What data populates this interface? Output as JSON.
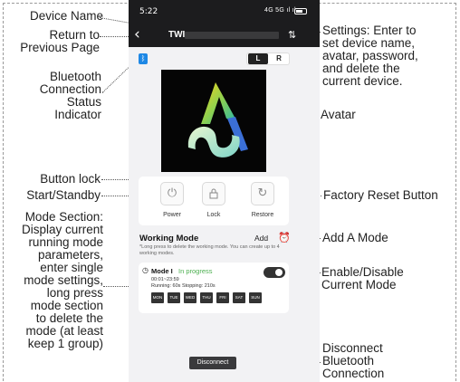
{
  "labels": {
    "device_name": "Device Name",
    "return_line1": "Return to",
    "return_line2": "Previous Page",
    "bluetooth": [
      "Bluetooth",
      "Connection",
      "Status",
      "Indicator"
    ],
    "button_lock": "Button lock",
    "start_standby": "Start/Standby",
    "mode_section": [
      "Mode Section:",
      "Display current",
      "running mode",
      "parameters,",
      "enter single",
      "mode settings,",
      "long press",
      "mode section",
      "to delete the",
      "mode (at least",
      "keep 1 group)"
    ],
    "settings": [
      "Settings: Enter to",
      "set device name,",
      "avatar, password,",
      "and delete the",
      "current device."
    ],
    "avatar": "Avatar",
    "factory_reset": "Factory Reset Button",
    "add_mode": "Add A Mode",
    "enable_disable": [
      "Enable/Disable",
      "Current Mode"
    ],
    "disconnect_bt": [
      "Disconnect",
      "Bluetooth",
      "Connection"
    ]
  },
  "phone": {
    "status_time": "5:22",
    "status_signal": "4G 5G ıl ıl",
    "nav_back_icon": "chevron-left-icon",
    "nav_title": "TWI",
    "settings_icon": "sliders-icon",
    "bluetooth_icon": "bluetooth-icon",
    "channel_left": "L",
    "channel_right": "R",
    "controls": [
      {
        "label": "Power",
        "icon": "power-icon",
        "glyph": "⏻"
      },
      {
        "label": "Lock",
        "icon": "lock-icon",
        "glyph": "🔒"
      },
      {
        "label": "Restore",
        "icon": "restore-icon",
        "glyph": "↻"
      }
    ],
    "working_mode": {
      "title": "Working Mode",
      "add_label": "Add",
      "note": "*Long press to delete the working mode. You can create up to 4 working modes.",
      "mode": {
        "name": "Mode I",
        "status": "In progress",
        "time": "00:01~23:59",
        "running": "Running:  60s  Stopping:  210s",
        "enabled": true,
        "days": [
          "MON",
          "TUE",
          "WED",
          "THU",
          "FRI",
          "SAT",
          "SUN"
        ]
      }
    },
    "disconnect_label": "Disconnect"
  },
  "colors": {
    "dark_bar": "#1c1c1e",
    "bluetooth_blue": "#1e88e5",
    "progress_green": "#4caf50",
    "phone_bg": "#f2f2f4"
  }
}
